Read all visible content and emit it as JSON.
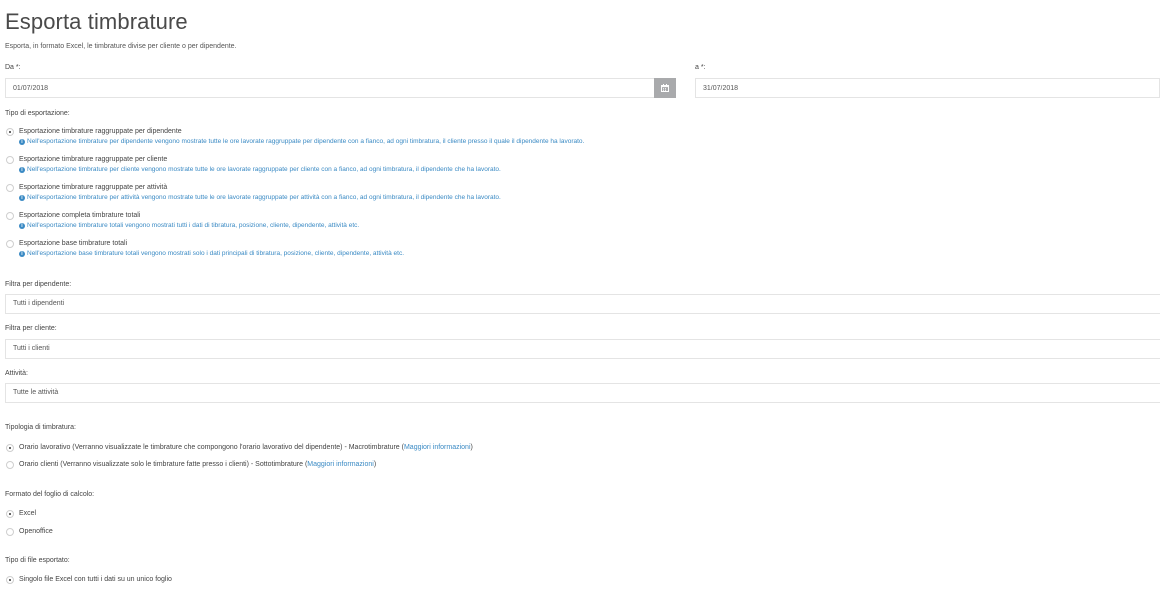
{
  "header": {
    "title": "Esporta timbrature",
    "subtitle": "Esporta, in formato Excel, le timbrature divise per cliente o per dipendente."
  },
  "date_range": {
    "from_label": "Da *:",
    "from_value": "01/07/2018",
    "to_label": "a *:",
    "to_value": "31/07/2018",
    "calendar_icon": "calendar-icon"
  },
  "export_type": {
    "label": "Tipo di esportazione:",
    "options": [
      {
        "label": "Esportazione timbrature raggruppate per dipendente",
        "info": "Nell'esportazione timbrature per dipendente vengono mostrate tutte le ore lavorate raggruppate per dipendente con a fianco, ad ogni timbratura, il cliente presso il quale il dipendente ha lavorato.",
        "checked": true
      },
      {
        "label": "Esportazione timbrature raggruppate per cliente",
        "info": "Nell'esportazione timbrature per cliente vengono mostrate tutte le ore lavorate raggruppate per cliente con a fianco, ad ogni timbratura, il dipendente che ha lavorato.",
        "checked": false
      },
      {
        "label": "Esportazione timbrature raggruppate per attività",
        "info": "Nell'esportazione timbrature per attività vengono mostrate tutte le ore lavorate raggruppate per attività con a fianco, ad ogni timbratura, il dipendente che ha lavorato.",
        "checked": false
      },
      {
        "label": "Esportazione completa timbrature totali",
        "info": "Nell'esportazione timbrature totali vengono mostrati tutti i dati di tibratura, posizione, cliente, dipendente, attività etc.",
        "checked": false
      },
      {
        "label": "Esportazione base timbrature totali",
        "info": "Nell'esportazione base timbrature totali vengono mostrati solo i dati principali di tibratura, posizione, cliente, dipendente, attività etc.",
        "checked": false
      }
    ],
    "info_icon": "info-icon"
  },
  "filters": {
    "employee_label": "Filtra per dipendente:",
    "employee_value": "Tutti i dipendenti",
    "client_label": "Filtra per cliente:",
    "client_value": "Tutti i clienti",
    "activity_label": "Attività:",
    "activity_value": "Tutte le attività"
  },
  "stamp_type": {
    "label": "Tipologia di timbratura:",
    "options": [
      {
        "label": "Orario lavorativo (Verranno visualizzate le timbrature che compongono l'orario lavorativo del dipendente) - Macrotimbrature (",
        "link": "Maggiori informazioni",
        "suffix": ")",
        "checked": true
      },
      {
        "label": "Orario clienti (Verranno visualizzate solo le timbrature fatte presso i clienti) - Sottotimbrature (",
        "link": "Maggiori informazioni",
        "suffix": ")",
        "checked": false
      }
    ]
  },
  "sheet_format": {
    "label": "Formato del foglio di calcolo:",
    "options": [
      {
        "label": "Excel",
        "checked": true
      },
      {
        "label": "Openoffice",
        "checked": false
      }
    ]
  },
  "file_type": {
    "label": "Tipo di file esportato:",
    "options": [
      {
        "label": "Singolo file Excel con tutti i dati su un unico foglio",
        "checked": true
      }
    ]
  },
  "colors": {
    "info_blue": "#3a8ac4",
    "calendar_button": "#a9aaac",
    "border": "#e4e4e4"
  }
}
